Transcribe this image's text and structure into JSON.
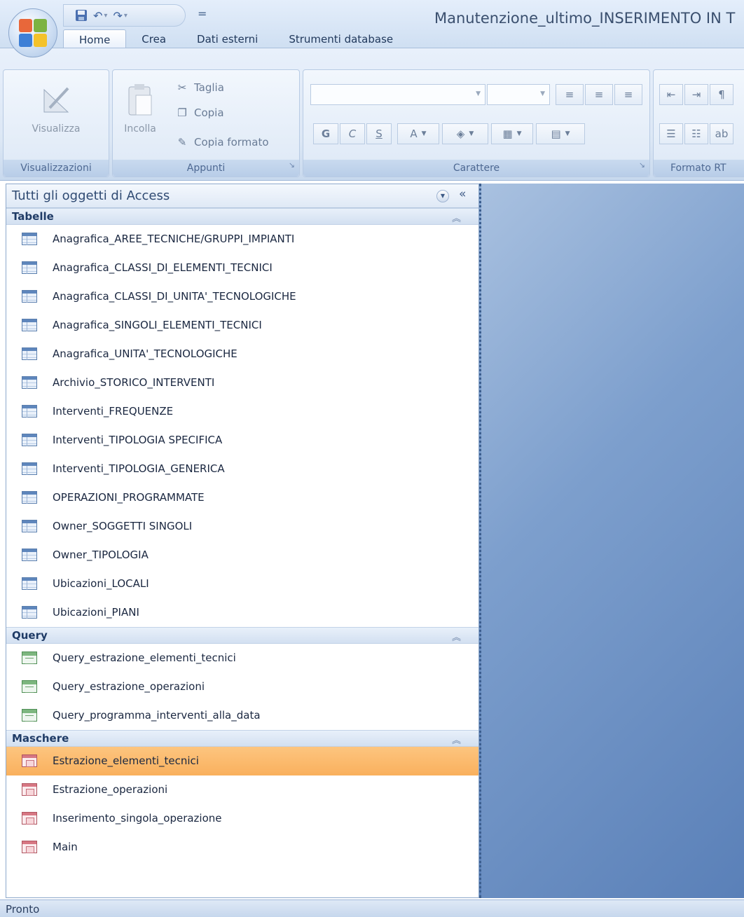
{
  "window": {
    "title": "Manutenzione_ultimo_INSERIMENTO IN T",
    "qat_separator": "="
  },
  "tabs": [
    {
      "label": "Home",
      "active": true
    },
    {
      "label": "Crea",
      "active": false
    },
    {
      "label": "Dati esterni",
      "active": false
    },
    {
      "label": "Strumenti database",
      "active": false
    }
  ],
  "ribbon": {
    "visualizzazioni": {
      "label": "Visualizzazioni",
      "visualizza": "Visualizza"
    },
    "appunti": {
      "label": "Appunti",
      "incolla": "Incolla",
      "taglia": "Taglia",
      "copia": "Copia",
      "copia_formato": "Copia formato"
    },
    "carattere": {
      "label": "Carattere",
      "bold": "G",
      "italic": "C",
      "underline": "S",
      "font_color": "A"
    },
    "formato_rtf": {
      "label": "Formato RT"
    }
  },
  "nav": {
    "title": "Tutti gli oggetti di Access",
    "shutter": "«",
    "groups": {
      "tabelle": {
        "label": "Tabelle",
        "items": [
          "Anagrafica_AREE_TECNICHE/GRUPPI_IMPIANTI",
          "Anagrafica_CLASSI_DI_ELEMENTI_TECNICI",
          "Anagrafica_CLASSI_DI_UNITA'_TECNOLOGICHE",
          "Anagrafica_SINGOLI_ELEMENTI_TECNICI",
          "Anagrafica_UNITA'_TECNOLOGICHE",
          "Archivio_STORICO_INTERVENTI",
          "Interventi_FREQUENZE",
          "Interventi_TIPOLOGIA SPECIFICA",
          "Interventi_TIPOLOGIA_GENERICA",
          "OPERAZIONI_PROGRAMMATE",
          "Owner_SOGGETTI SINGOLI",
          "Owner_TIPOLOGIA",
          "Ubicazioni_LOCALI",
          "Ubicazioni_PIANI"
        ]
      },
      "query": {
        "label": "Query",
        "items": [
          "Query_estrazione_elementi_tecnici",
          "Query_estrazione_operazioni",
          "Query_programma_interventi_alla_data"
        ]
      },
      "maschere": {
        "label": "Maschere",
        "items": [
          "Estrazione_elementi_tecnici",
          "Estrazione_operazioni",
          "Inserimento_singola_operazione",
          "Main"
        ],
        "selected": "Estrazione_elementi_tecnici"
      }
    }
  },
  "status": {
    "text": "Pronto"
  },
  "icons": {
    "table": "table-icon",
    "query": "query-icon",
    "form": "form-icon"
  },
  "colors": {
    "selection": "#f9b05d",
    "workarea": "#6a8fc4",
    "ribbon": "#dce7f5"
  }
}
